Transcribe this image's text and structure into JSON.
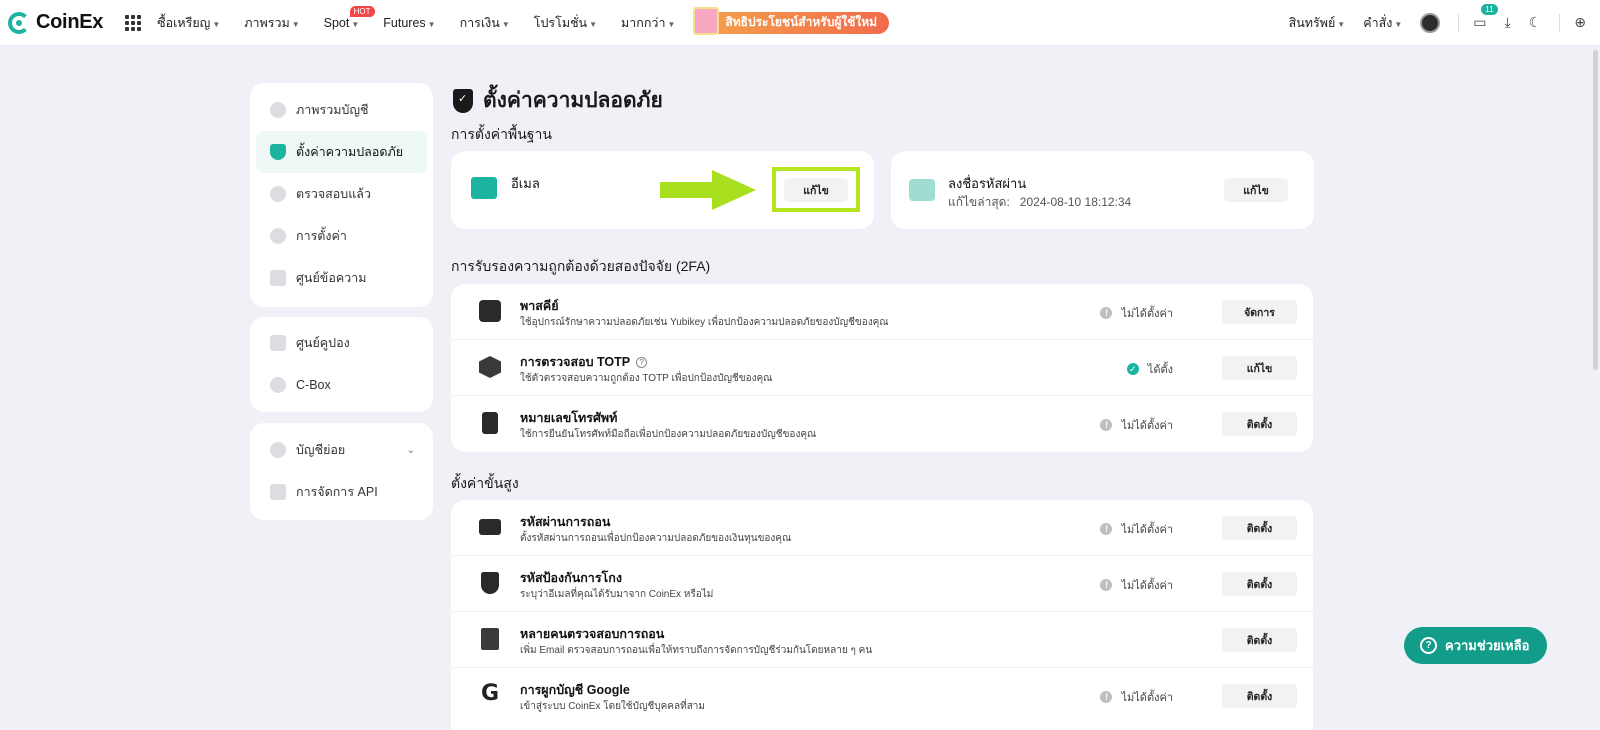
{
  "brand": {
    "name": "CoinEx",
    "accent": "#1bb4a0"
  },
  "topnav": {
    "items": [
      {
        "label": "ซื้อเหรียญ"
      },
      {
        "label": "ภาพรวม"
      },
      {
        "label": "Spot",
        "badge": "HOT"
      },
      {
        "label": "Futures"
      },
      {
        "label": "การเงิน"
      },
      {
        "label": "โปรโมชั่น"
      },
      {
        "label": "มากกว่า"
      }
    ],
    "promo_label": "สิทธิประโยชน์สำหรับผู้ใช้ใหม่",
    "assets_label": "สินทรัพย์",
    "orders_label": "คำสั่ง",
    "notification_count": "11",
    "icons": [
      "grid-icon",
      "avatar-icon",
      "message-icon",
      "download-icon",
      "moon-icon",
      "globe-icon"
    ]
  },
  "sidebar": {
    "group1": [
      {
        "label": "ภาพรวมบัญชี"
      },
      {
        "label": "ตั้งค่าความปลอดภัย",
        "active": true
      },
      {
        "label": "ตรวจสอบแล้ว"
      },
      {
        "label": "การตั้งค่า"
      },
      {
        "label": "ศูนย์ข้อความ"
      }
    ],
    "group2": [
      {
        "label": "ศูนย์คูปอง"
      },
      {
        "label": "C-Box"
      }
    ],
    "group3": [
      {
        "label": "บัญชีย่อย"
      },
      {
        "label": "การจัดการ API"
      }
    ]
  },
  "main": {
    "title": "ตั้งค่าความปลอดภัย",
    "basic_title": "การตั้งค่าพื้นฐาน",
    "email": {
      "title": "อีเมล",
      "button": "แก้ไข"
    },
    "login_password": {
      "title": "ลงชื่อรหัสผ่าน",
      "sub_label": "แก้ไขล่าสุด:",
      "sub_value": "2024-08-10 18:12:34",
      "button": "แก้ไข"
    },
    "twofa_title": "การรับรองความถูกต้องด้วยสองปัจจัย (2FA)",
    "twofa": [
      {
        "title": "พาสคีย์",
        "desc": "ใช้อุปกรณ์รักษาความปลอดภัยเช่น Yubikey เพื่อปกป้องความปลอดภัยของบัญชีของคุณ",
        "status": "ไม่ได้ตั้งค่า",
        "button": "จัดการ"
      },
      {
        "title": "การตรวจสอบ TOTP",
        "desc": "ใช้ตัวตรวจสอบความถูกต้อง TOTP เพื่อปกป้องบัญชีของคุณ",
        "status": "ได้ตั้ง",
        "button": "แก้ไข"
      },
      {
        "title": "หมายเลขโทรศัพท์",
        "desc": "ใช้การยืนยันโทรศัพท์มือถือเพื่อปกป้องความปลอดภัยของบัญชีของคุณ",
        "status": "ไม่ได้ตั้งค่า",
        "button": "ติดตั้ง"
      }
    ],
    "advanced_title": "ตั้งค่าขั้นสูง",
    "advanced": [
      {
        "title": "รหัสผ่านการถอน",
        "desc": "ตั้งรหัสผ่านการถอนเพื่อปกป้องความปลอดภัยของเงินทุนของคุณ",
        "status": "ไม่ได้ตั้งค่า",
        "button": "ติดตั้ง"
      },
      {
        "title": "รหัสป้องกันการโกง",
        "desc": "ระบุว่าอีเมลที่คุณได้รับมาจาก CoinEx หรือไม่",
        "status": "ไม่ได้ตั้งค่า",
        "button": "ติดตั้ง"
      },
      {
        "title": "หลายคนตรวจสอบการถอน",
        "desc": "เพิ่ม Email ตรวจสอบการถอนเพื่อให้ทราบถึงการจัดการบัญชีร่วมกันโดยหลาย ๆ คน",
        "status": "",
        "button": "ติดตั้ง"
      },
      {
        "title": "การผูกบัญชี Google",
        "desc": "เข้าสู่ระบบ CoinEx โดยใช้บัญชีบุคคลที่สาม",
        "status": "ไม่ได้ตั้งค่า",
        "button": "ติดตั้ง"
      }
    ]
  },
  "help_label": "ความช่วยเหลือ"
}
